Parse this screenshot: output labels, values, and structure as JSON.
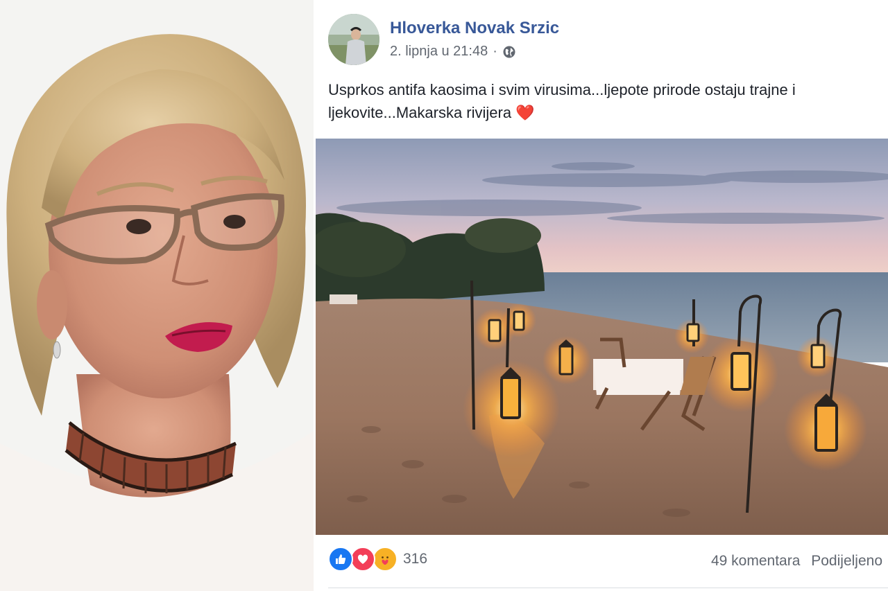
{
  "post": {
    "author": "Hloverka Novak Srzic",
    "date": "2. lipnja u 21:48",
    "separator": "·",
    "audience_icon": "globe-icon",
    "text": "Usprkos antifa kaosima i svim virusima...ljepote prirode ostaju trajne i ljekovite...Makarska rivijera",
    "text_emoji": "❤️",
    "reactions": {
      "icons": [
        "like-icon",
        "love-icon",
        "care-icon"
      ],
      "count": "316"
    },
    "comments": "49 komentara",
    "shared": "Podijeljeno"
  },
  "colors": {
    "author_link": "#385898",
    "meta_text": "#616770",
    "like": "#1877f2",
    "love": "#f33e58",
    "care": "#f7b125"
  }
}
